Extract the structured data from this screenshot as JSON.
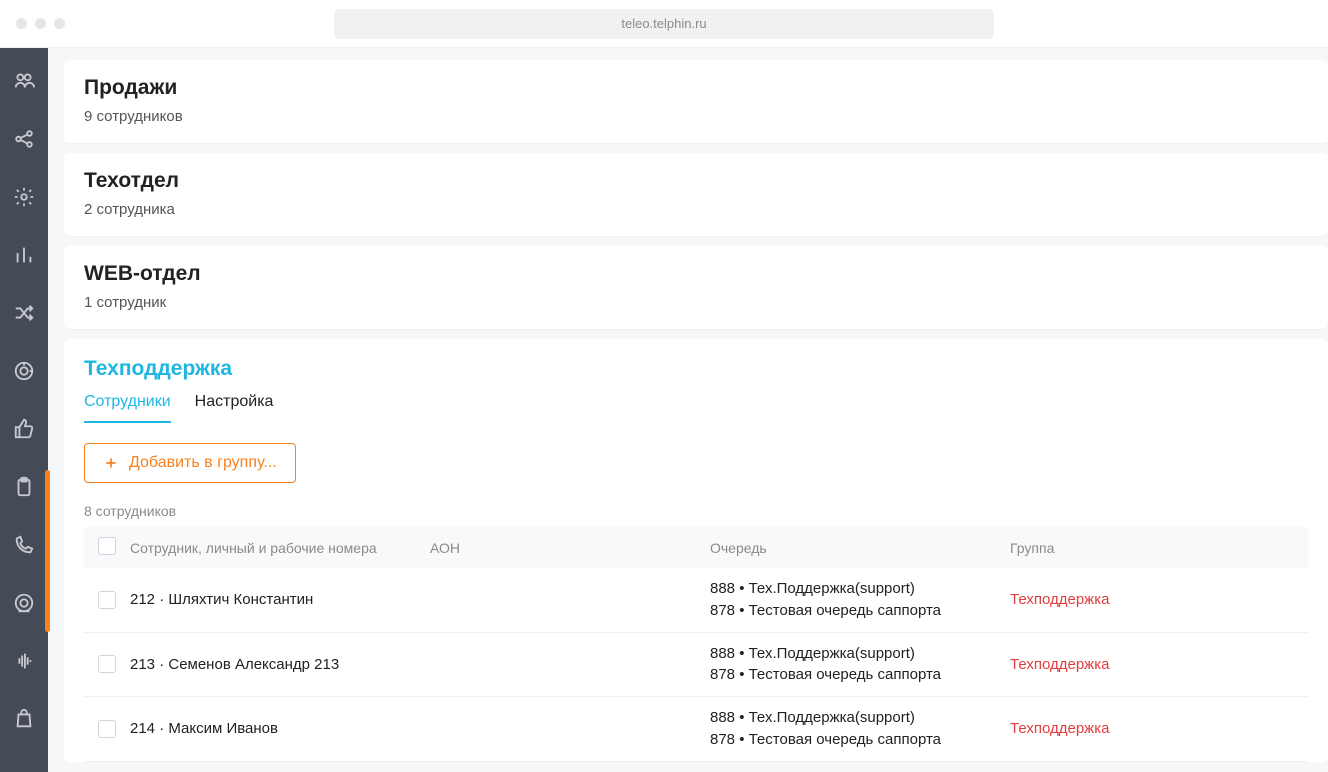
{
  "browser": {
    "url": "teleo.telphin.ru"
  },
  "departments": [
    {
      "title": "Продажи",
      "subtitle": "9 сотрудников"
    },
    {
      "title": "Техотдел",
      "subtitle": "2 сотрудника"
    },
    {
      "title": "WEB-отдел",
      "subtitle": "1 сотрудник"
    }
  ],
  "detail": {
    "title": "Техподдержка",
    "tabs": {
      "employees": "Сотрудники",
      "settings": "Настройка"
    },
    "add_button": "Добавить в группу...",
    "count": "8 сотрудников",
    "columns": {
      "employee": "Сотрудник, личный и рабочие номера",
      "aon": "АОН",
      "queue": "Очередь",
      "group": "Группа"
    },
    "rows": [
      {
        "employee": "212 · Шляхтич Константин",
        "queue_line1": "888 • Тех.Поддержка(support)",
        "queue_line2": "878 • Тестовая очередь саппорта",
        "group": "Техподдержка"
      },
      {
        "employee": "213 · Семенов Александр 213",
        "queue_line1": "888 • Тех.Поддержка(support)",
        "queue_line2": "878 • Тестовая очередь саппорта",
        "group": "Техподдержка"
      },
      {
        "employee": "214 · Максим Иванов",
        "queue_line1": "888 • Тех.Поддержка(support)",
        "queue_line2": "878 • Тестовая очередь саппорта",
        "group": "Техподдержка"
      }
    ]
  }
}
